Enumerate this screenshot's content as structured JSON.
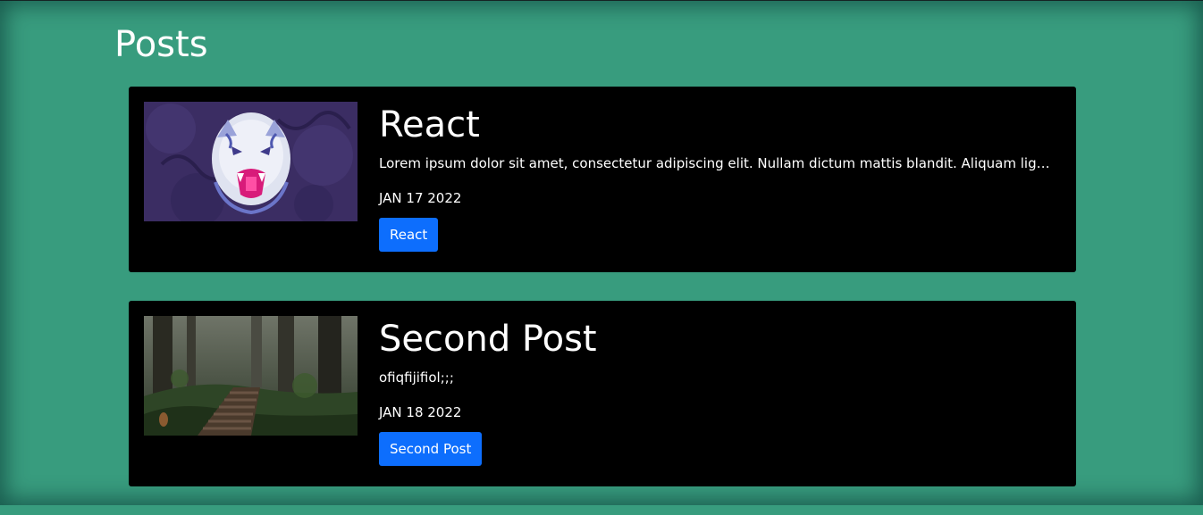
{
  "page": {
    "title": "Posts"
  },
  "posts": [
    {
      "title": "React",
      "excerpt": "Lorem ipsum dolor sit amet, consectetur adipiscing elit. Nullam dictum mattis blandit. Aliquam ligula",
      "date": "JAN 17 2022",
      "tag_label": "React",
      "thumbnail": "tiger-illustration"
    },
    {
      "title": "Second Post",
      "excerpt": "ofiqfijifiol;;;",
      "date": "JAN 18 2022",
      "tag_label": "Second Post",
      "thumbnail": "forest-path-photo"
    }
  ],
  "colors": {
    "background": "#389c7e",
    "card": "#000000",
    "button": "#0d6efd",
    "text": "#ffffff"
  }
}
